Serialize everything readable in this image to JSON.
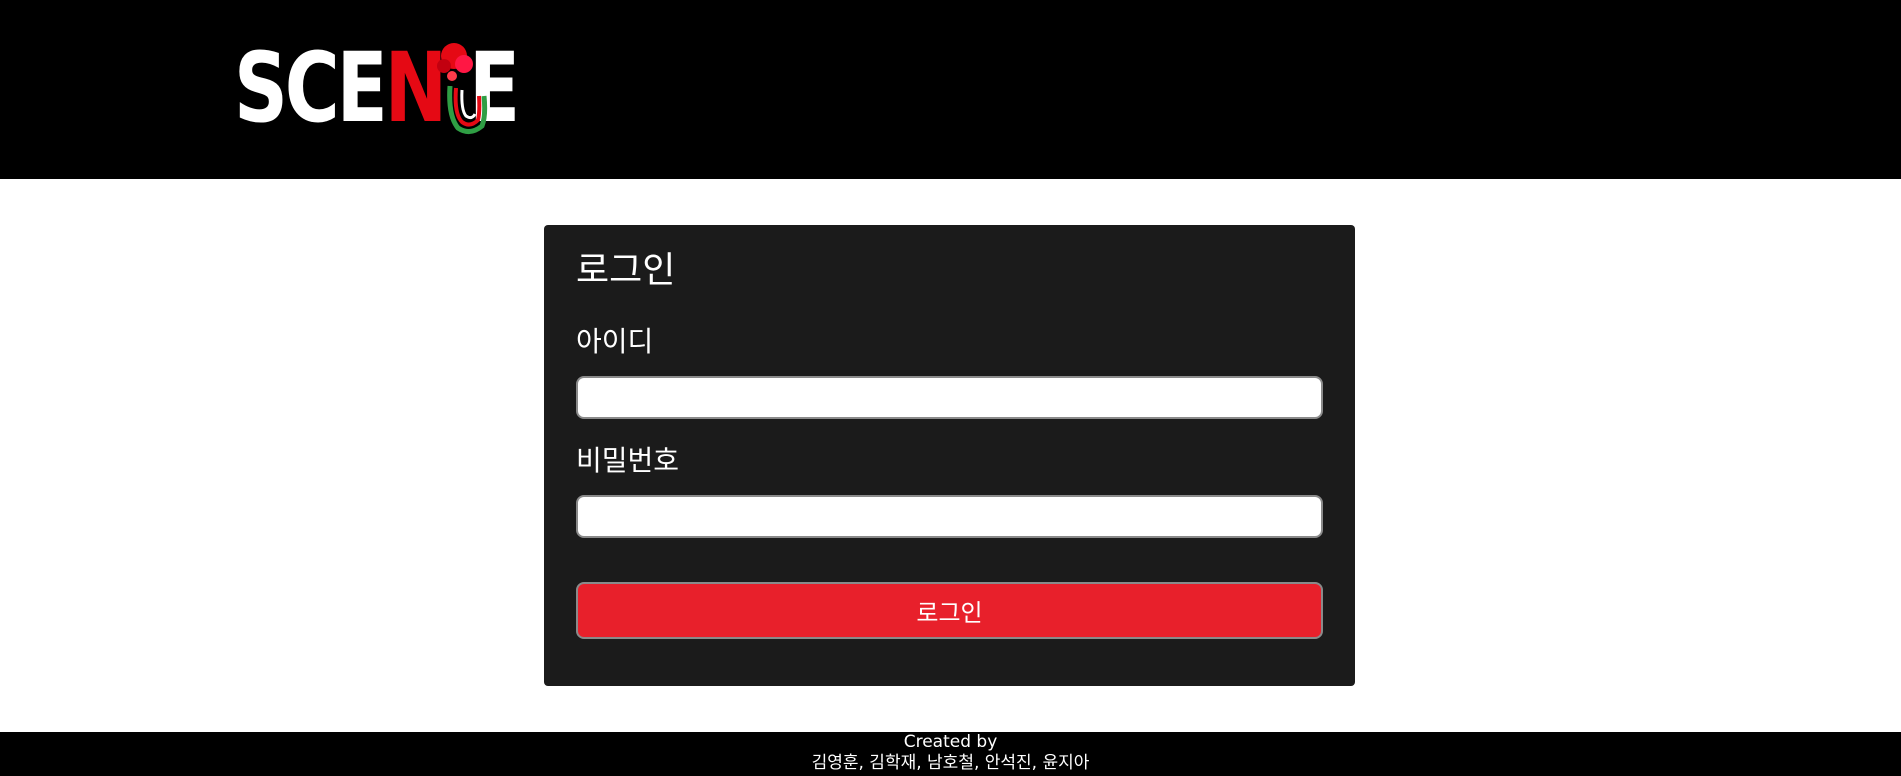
{
  "header": {
    "logo_text": "SCENE",
    "logo_icon": "scene-logo-icon"
  },
  "login": {
    "title": "로그인",
    "id_label": "아이디",
    "id_value": "",
    "password_label": "비밀번호",
    "password_value": "",
    "submit_label": "로그인"
  },
  "footer": {
    "created_by": "Created by",
    "authors": "김영훈, 김학재, 남호철, 안석진, 윤지아"
  },
  "colors": {
    "header_bg": "#000000",
    "card_bg": "#1b1b1b",
    "accent": "#e8202b",
    "logo_n": "#e50914"
  }
}
